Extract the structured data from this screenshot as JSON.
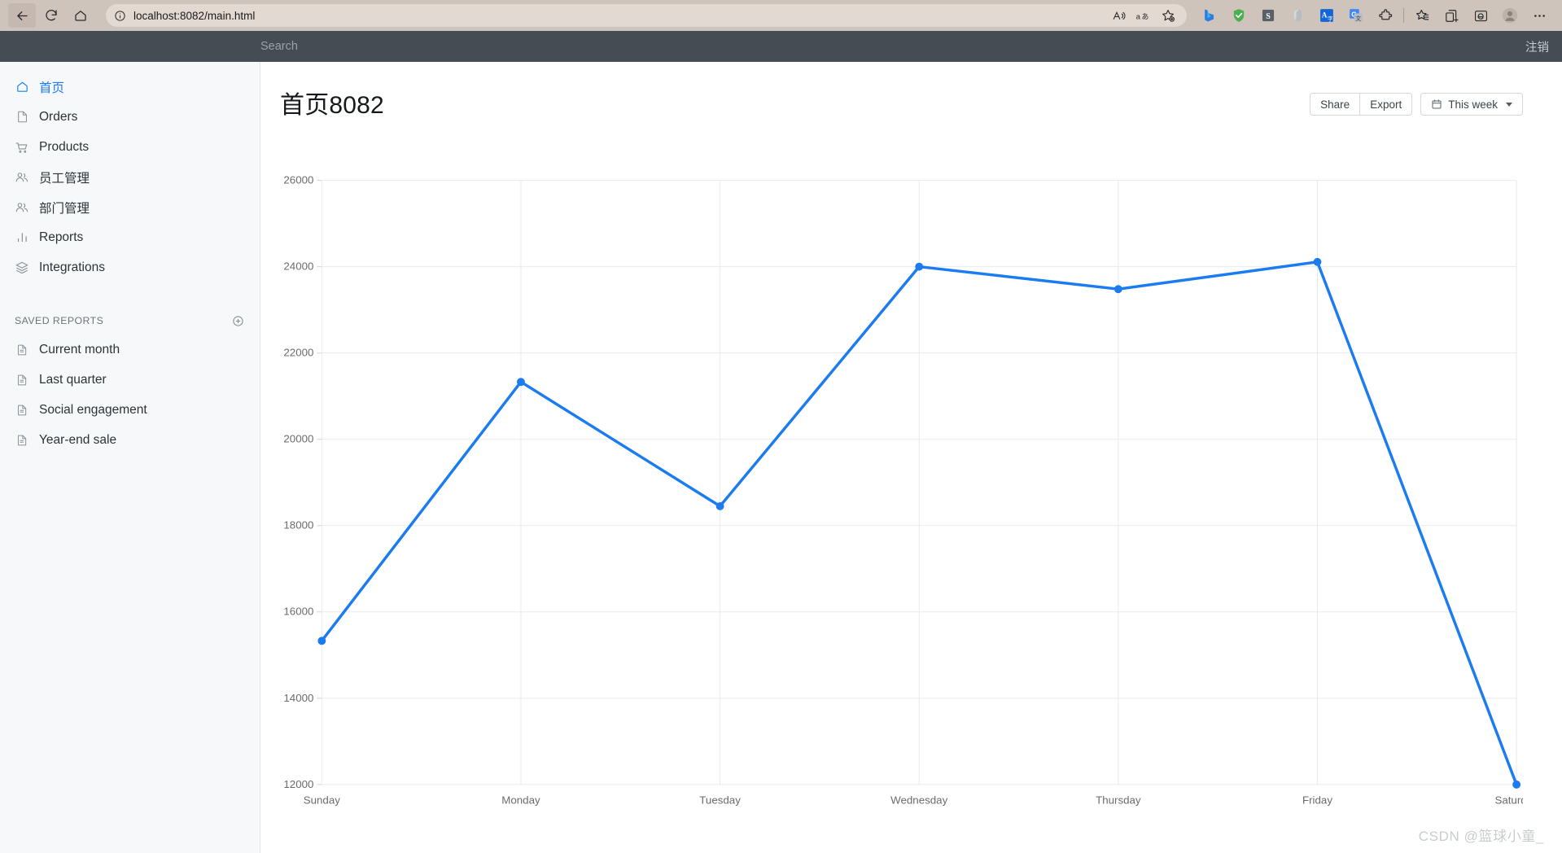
{
  "browser": {
    "back_tooltip": "Back",
    "refresh_tooltip": "Refresh",
    "home_tooltip": "Home",
    "url_prefix": "localhost",
    "url_suffix": ":8082/main.html",
    "url_full": "localhost:8082/main.html",
    "icons": {
      "info": "site-info-icon",
      "read_aloud": "read-aloud-icon",
      "translate": "translate-icon",
      "favorite": "add-favorite-icon",
      "bing": "bing-copilot-icon",
      "shield": "adblock-shield-icon",
      "snipaste": "snipaste-icon",
      "office": "office-icon",
      "dict": "dictionary-translate-icon",
      "gtranslate": "google-translate-icon",
      "extensions": "extensions-puzzle-icon",
      "collections": "collections-icon",
      "split": "split-screen-icon",
      "ie_mode": "ie-mode-icon",
      "profile": "profile-avatar-icon",
      "more": "more-settings-icon"
    }
  },
  "topbar": {
    "search_placeholder": "Search",
    "logout_label": "注销"
  },
  "sidebar": {
    "items": [
      {
        "label": "首页",
        "icon": "home-icon",
        "selected": true
      },
      {
        "label": "Orders",
        "icon": "file-icon",
        "selected": false
      },
      {
        "label": "Products",
        "icon": "cart-icon",
        "selected": false
      },
      {
        "label": "员工管理",
        "icon": "users-icon",
        "selected": false
      },
      {
        "label": "部门管理",
        "icon": "users-icon",
        "selected": false
      },
      {
        "label": "Reports",
        "icon": "bar-chart-icon",
        "selected": false
      },
      {
        "label": "Integrations",
        "icon": "layers-icon",
        "selected": false
      }
    ],
    "section": {
      "title": "SAVED REPORTS",
      "add_icon": "plus-circle-icon",
      "items": [
        {
          "label": "Current month",
          "icon": "document-icon"
        },
        {
          "label": "Last quarter",
          "icon": "document-icon"
        },
        {
          "label": "Social engagement",
          "icon": "document-icon"
        },
        {
          "label": "Year-end sale",
          "icon": "document-icon"
        }
      ]
    }
  },
  "page": {
    "title": "首页8082",
    "actions": {
      "share_label": "Share",
      "export_label": "Export",
      "date_label": "This week",
      "calendar_icon": "calendar-icon",
      "chevron_icon": "chevron-down-icon"
    }
  },
  "watermark": "CSDN @篮球小童_",
  "colors": {
    "accent": "#1a7cf0",
    "line": "#1a7cf0",
    "topbar": "#454c53",
    "sidebar": "#f7f8f9",
    "grid": "#e8eaec",
    "axis_text": "#6b6b6b"
  },
  "chart_data": {
    "type": "line",
    "title": "",
    "xlabel": "",
    "ylabel": "",
    "categories": [
      "Sunday",
      "Monday",
      "Tuesday",
      "Wednesday",
      "Thursday",
      "Friday",
      "Saturday"
    ],
    "values": [
      15330,
      21330,
      18450,
      24000,
      23480,
      24110,
      12000
    ],
    "ylim": [
      12000,
      26000
    ],
    "yticks": [
      12000,
      14000,
      16000,
      18000,
      20000,
      22000,
      24000,
      26000
    ],
    "ytick_labels": [
      "12000",
      "14000",
      "16000",
      "18000",
      "20000",
      "22000",
      "24000",
      "26000"
    ],
    "grid": true,
    "legend": false,
    "markers": true,
    "line_color": "#1a7cf0",
    "line_width": 3.5,
    "marker_radius": 5
  }
}
